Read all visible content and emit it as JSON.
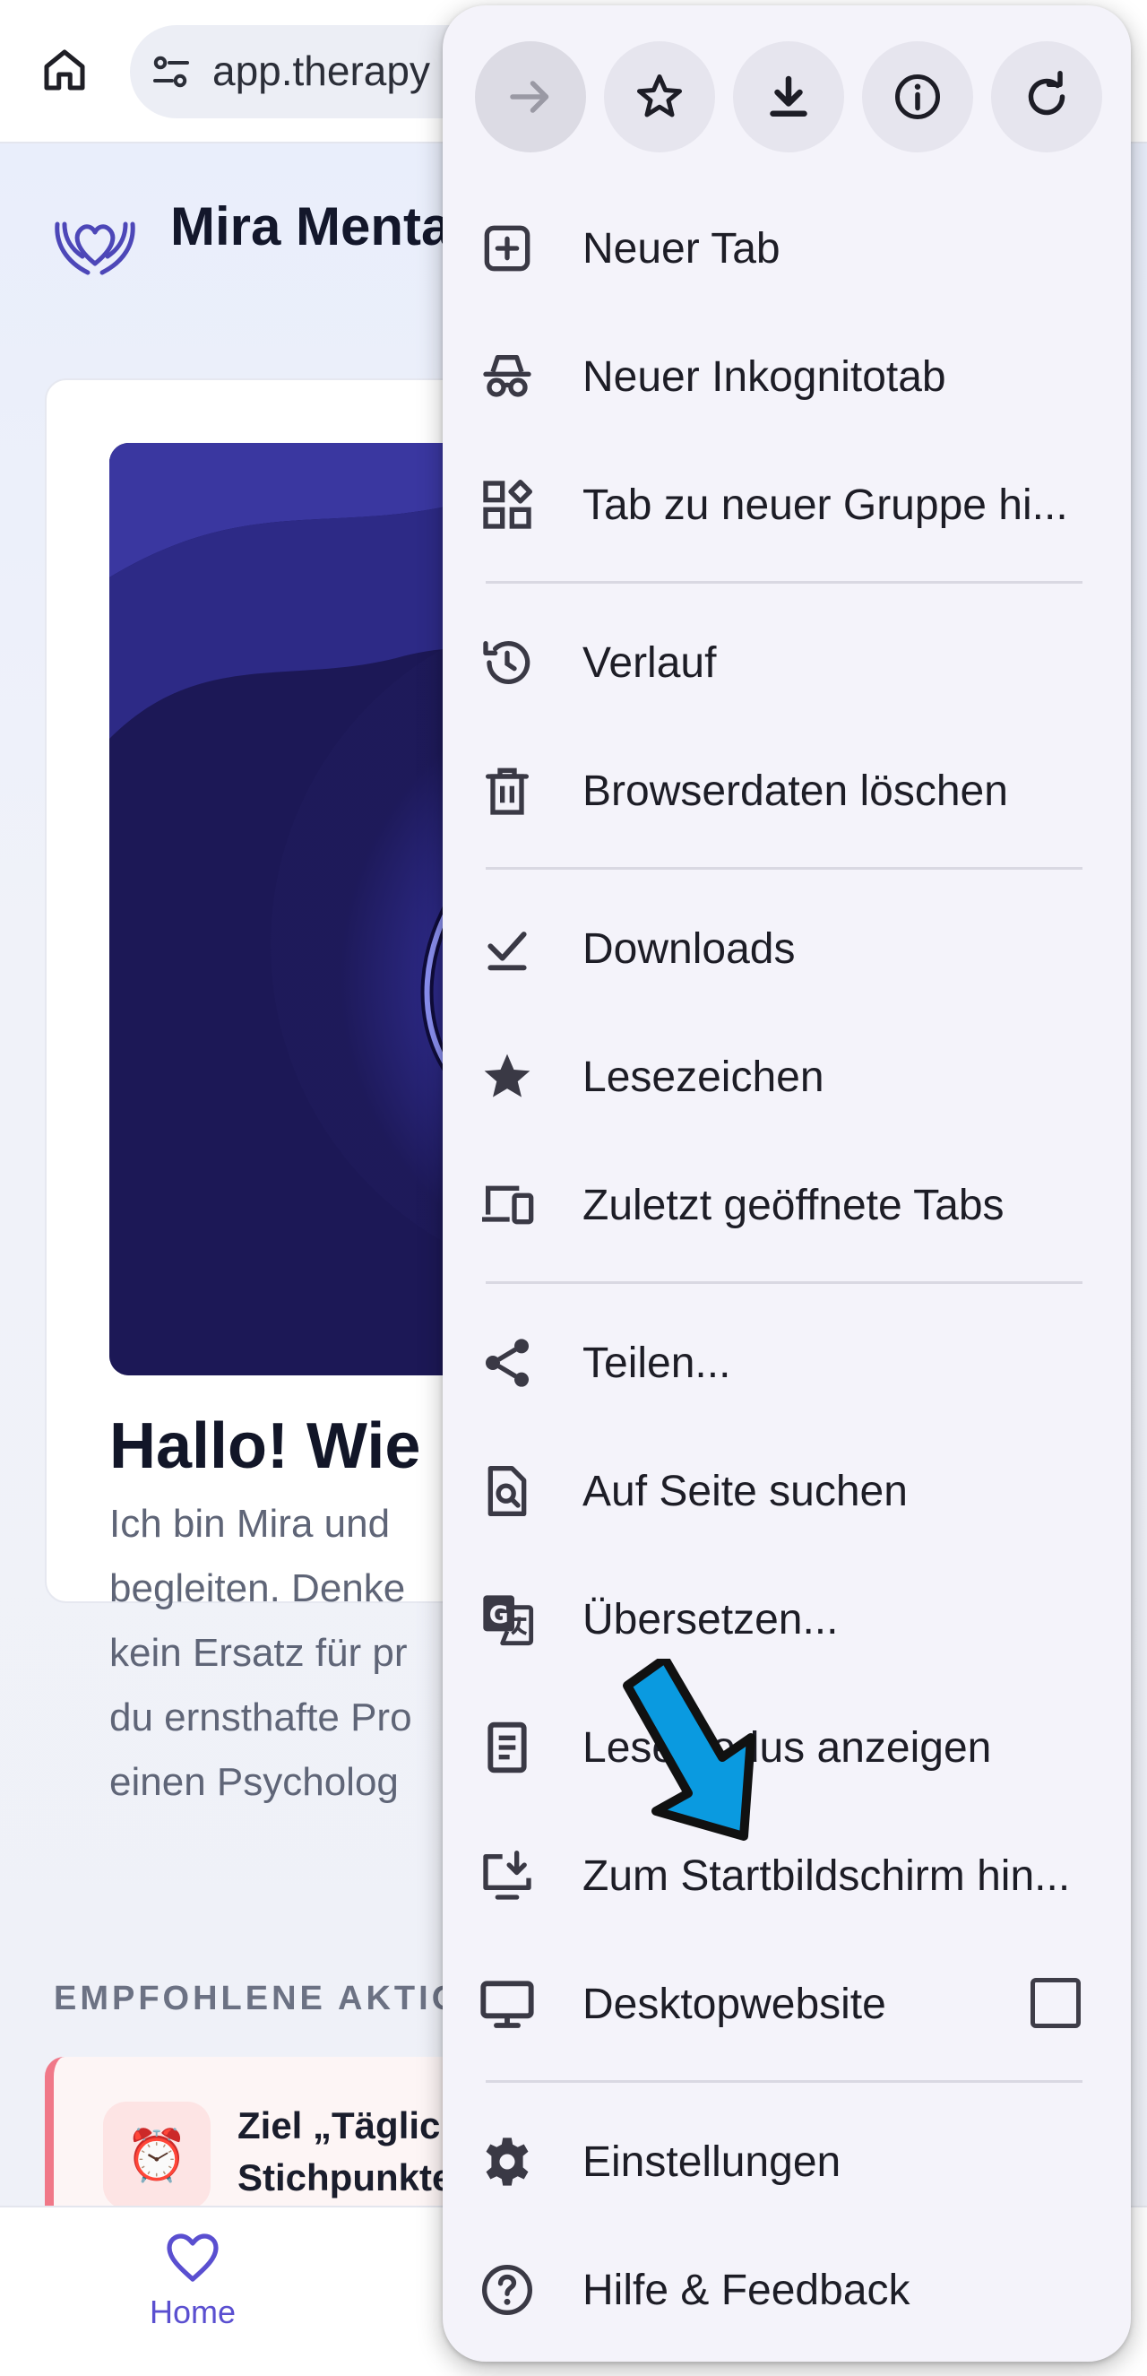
{
  "browser": {
    "url": "app.therapy"
  },
  "app": {
    "brand_name": "Mira Menta",
    "card_title": "Hallo! Wie",
    "card_body_lines": [
      "Ich bin Mira und",
      "begleiten. Denke",
      "kein Ersatz für pr",
      "du ernsthafte Pro",
      "einen Psycholog"
    ],
    "section_title": "EMPFOHLENE AKTIO",
    "action": {
      "icon": "alarm-clock-icon",
      "title_lines": [
        "Ziel „Täglich",
        "Stichpunkte"
      ]
    },
    "bottom_nav": {
      "home_label": "Home"
    }
  },
  "menu": {
    "toolbar": [
      {
        "name": "forward",
        "icon": "arrow-right-icon",
        "enabled": false
      },
      {
        "name": "bookmark",
        "icon": "star-outline-icon",
        "enabled": true
      },
      {
        "name": "download",
        "icon": "download-icon",
        "enabled": true
      },
      {
        "name": "page-info",
        "icon": "info-icon",
        "enabled": true
      },
      {
        "name": "reload",
        "icon": "reload-icon",
        "enabled": true
      }
    ],
    "items": [
      {
        "label": "Neuer Tab",
        "icon": "plus-box-icon"
      },
      {
        "label": "Neuer Inkognitotab",
        "icon": "incognito-icon"
      },
      {
        "label": "Tab zu neuer Gruppe hi...",
        "icon": "tab-group-icon"
      },
      {
        "label": "Verlauf",
        "icon": "history-icon"
      },
      {
        "label": "Browserdaten löschen",
        "icon": "trash-icon"
      },
      {
        "label": "Downloads",
        "icon": "download-done-icon"
      },
      {
        "label": "Lesezeichen",
        "icon": "star-filled-icon"
      },
      {
        "label": "Zuletzt geöffnete Tabs",
        "icon": "devices-icon"
      },
      {
        "label": "Teilen...",
        "icon": "share-icon"
      },
      {
        "label": "Auf Seite suchen",
        "icon": "find-in-page-icon"
      },
      {
        "label": "Übersetzen...",
        "icon": "translate-icon"
      },
      {
        "label": "Lesemodus anzeigen",
        "icon": "reader-mode-icon"
      },
      {
        "label": "Zum Startbildschirm hin...",
        "icon": "install-desktop-icon"
      },
      {
        "label": "Desktopwebsite",
        "icon": "desktop-icon",
        "checkbox": false
      },
      {
        "label": "Einstellungen",
        "icon": "settings-gear-icon"
      },
      {
        "label": "Hilfe & Feedback",
        "icon": "help-icon"
      }
    ]
  },
  "colors": {
    "accent": "#5a4fd0",
    "arrow": "#0a9ae0",
    "menu_bg": "#f4f3fa"
  }
}
